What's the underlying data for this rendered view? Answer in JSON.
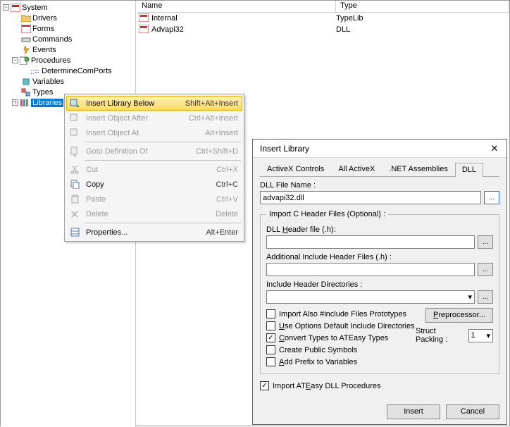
{
  "tree": {
    "root": "System",
    "items": [
      "Drivers",
      "Forms",
      "Commands",
      "Events",
      "Procedures",
      "DetermineComPorts",
      "Variables",
      "Types",
      "Libraries"
    ]
  },
  "list": {
    "cols": {
      "name": "Name",
      "type": "Type"
    },
    "rows": [
      {
        "name": "Internal",
        "type": "TypeLib"
      },
      {
        "name": "Advapi32",
        "type": "DLL"
      }
    ]
  },
  "menu": {
    "insert_below": {
      "label": "Insert Library Below",
      "shortcut": "Shift+Alt+Insert"
    },
    "insert_after": {
      "label": "Insert Object After",
      "shortcut": "Ctrl+Alt+Insert"
    },
    "insert_at": {
      "label": "Insert Object At",
      "shortcut": "Alt+Insert"
    },
    "goto_def": {
      "label": "Goto Definition Of",
      "shortcut": "Ctrl+Shift+D"
    },
    "cut": {
      "label": "Cut",
      "shortcut": "Ctrl+X"
    },
    "copy": {
      "label": "Copy",
      "shortcut": "Ctrl+C"
    },
    "paste": {
      "label": "Paste",
      "shortcut": "Ctrl+V"
    },
    "delete": {
      "label": "Delete",
      "shortcut": "Delete"
    },
    "props": {
      "label": "Properties...",
      "shortcut": "Alt+Enter"
    }
  },
  "dialog": {
    "title": "Insert Library",
    "tabs": [
      "ActiveX Controls",
      "All ActiveX",
      ".NET Assemblies",
      "DLL"
    ],
    "active_tab": "DLL",
    "dll_label": "DLL File Name :",
    "dll_value": "advapi32.dll",
    "group_label": "Import C Header Files (Optional) :",
    "hdr_label": "DLL Header file (.h):",
    "hdr_value": "",
    "add_hdr_label": "Additional Include Header Files (.h) :",
    "add_hdr_value": "",
    "inc_dir_label": "Include Header Directories :",
    "inc_dir_value": "",
    "opt_import_also": "Import Also #include Files Prototypes",
    "opt_use_default": "Use Options Default Include Directories",
    "opt_convert": "Convert Types to ATEasy Types",
    "opt_public": "Create Public Symbols",
    "opt_prefix": "Add Prefix to Variables",
    "preproc_btn": "Preprocessor...",
    "pack_label": "Struct Packing :",
    "pack_value": "1",
    "import_proc": "Import ATEasy DLL Procedures",
    "insert_btn": "Insert",
    "cancel_btn": "Cancel"
  }
}
